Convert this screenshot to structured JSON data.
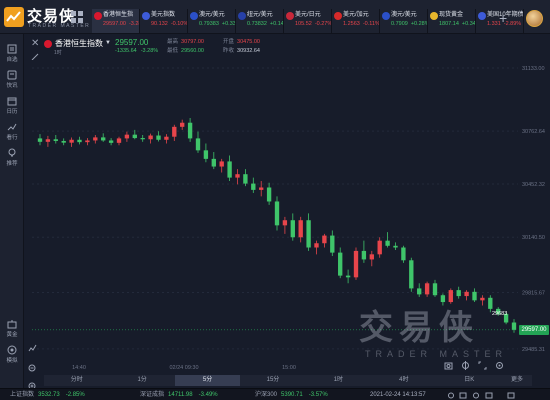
{
  "app": {
    "brand": "交易侠",
    "brand_sub": "TRADER MASTER"
  },
  "colors": {
    "up": "#3fc56a",
    "down": "#e8454b",
    "accent": "#f0a020",
    "background": "#171c2a"
  },
  "tabs": [
    {
      "name": "香港恒生指",
      "value": "29597.00",
      "change": "-3.28%",
      "dir": "down",
      "flag": "#d8182e",
      "active": true
    },
    {
      "name": "美元指数",
      "value": "90.132",
      "change": "-0.10%",
      "dir": "down",
      "flag": "#3d5bd9",
      "active": false
    },
    {
      "name": "澳元/美元",
      "value": "0.79383",
      "change": "+0.33%",
      "dir": "up",
      "flag": "#2b50c8",
      "active": false
    },
    {
      "name": "纽元/美元",
      "value": "0.73832",
      "change": "+0.14%",
      "dir": "up",
      "flag": "#2740a8",
      "active": false
    },
    {
      "name": "美元/日元",
      "value": "105.52",
      "change": "-0.27%",
      "dir": "down",
      "flag": "#c8283a",
      "active": false
    },
    {
      "name": "美元/加元",
      "value": "1.2563",
      "change": "-0.11%",
      "dir": "down",
      "flag": "#d62a2a",
      "active": false
    },
    {
      "name": "澳元/美元",
      "value": "0.7909",
      "change": "+0.28%",
      "dir": "up",
      "flag": "#2b50c8",
      "active": false
    },
    {
      "name": "现货黄金",
      "value": "1807.14",
      "change": "+0.34%",
      "dir": "up",
      "flag": "#e7b62c",
      "active": false
    },
    {
      "name": "美国10年期债...",
      "value": "1.331",
      "change": "-2.89%",
      "dir": "down",
      "flag": "#3d5bd9",
      "active": false
    }
  ],
  "sidebar": [
    {
      "label": "自选",
      "icon": "star-icon"
    },
    {
      "label": "快讯",
      "icon": "news-icon"
    },
    {
      "label": "日历",
      "icon": "calendar-icon"
    },
    {
      "label": "看行",
      "icon": "trend-icon"
    },
    {
      "label": "推荐",
      "icon": "bulb-icon"
    }
  ],
  "sidebar_bottom": [
    {
      "label": "黄金",
      "icon": "gold-icon"
    },
    {
      "label": "模拟",
      "icon": "simulate-icon"
    }
  ],
  "symbol": {
    "name": "香港恒生指数",
    "sub": "1时",
    "price": "29597.00",
    "change": "-1335.64",
    "change_pct": "-3.28%",
    "stats": [
      {
        "k": "最高",
        "v": "30797.00",
        "dir": "down"
      },
      {
        "k": "开盘",
        "v": "30475.00",
        "dir": "down"
      },
      {
        "k": "最低",
        "v": "29560.00",
        "dir": "up"
      },
      {
        "k": "昨收",
        "v": "30932.64",
        "dir": "neutral"
      }
    ]
  },
  "chart_data": {
    "type": "candlestick",
    "y_ticks": [
      "31133.00",
      "30762.64",
      "30452.32",
      "30140.50",
      "29815.67",
      "29485.31"
    ],
    "x_ticks": [
      "14:40",
      "02/24 09:30",
      "15:00"
    ],
    "last_price": "29597.00",
    "low_label": "29683",
    "ylim": [
      29420,
      31180
    ],
    "candles": [
      [
        30720,
        30745,
        30680,
        30700
      ],
      [
        30700,
        30735,
        30670,
        30715
      ],
      [
        30715,
        30740,
        30690,
        30705
      ],
      [
        30705,
        30720,
        30680,
        30695
      ],
      [
        30695,
        30725,
        30670,
        30712
      ],
      [
        30712,
        30730,
        30685,
        30698
      ],
      [
        30698,
        30722,
        30680,
        30708
      ],
      [
        30708,
        30740,
        30690,
        30726
      ],
      [
        30726,
        30750,
        30700,
        30708
      ],
      [
        30708,
        30722,
        30680,
        30694
      ],
      [
        30694,
        30730,
        30680,
        30720
      ],
      [
        30720,
        30760,
        30700,
        30742
      ],
      [
        30742,
        30770,
        30715,
        30722
      ],
      [
        30722,
        30740,
        30700,
        30715
      ],
      [
        30715,
        30748,
        30690,
        30737
      ],
      [
        30737,
        30762,
        30702,
        30712
      ],
      [
        30712,
        30745,
        30690,
        30730
      ],
      [
        30730,
        30800,
        30705,
        30788
      ],
      [
        30788,
        30830,
        30770,
        30812
      ],
      [
        30812,
        30840,
        30700,
        30720
      ],
      [
        30720,
        30760,
        30635,
        30650
      ],
      [
        30650,
        30690,
        30580,
        30600
      ],
      [
        30600,
        30640,
        30540,
        30555
      ],
      [
        30555,
        30600,
        30520,
        30585
      ],
      [
        30585,
        30620,
        30470,
        30490
      ],
      [
        30490,
        30540,
        30450,
        30510
      ],
      [
        30510,
        30540,
        30440,
        30455
      ],
      [
        30455,
        30490,
        30400,
        30418
      ],
      [
        30418,
        30470,
        30380,
        30432
      ],
      [
        30432,
        30460,
        30330,
        30350
      ],
      [
        30350,
        30380,
        30180,
        30210
      ],
      [
        30210,
        30260,
        30160,
        30240
      ],
      [
        30240,
        30280,
        30120,
        30140
      ],
      [
        30140,
        30260,
        30110,
        30240
      ],
      [
        30240,
        30280,
        30060,
        30080
      ],
      [
        30080,
        30120,
        30040,
        30105
      ],
      [
        30105,
        30160,
        30080,
        30150
      ],
      [
        30150,
        30180,
        30030,
        30050
      ],
      [
        30050,
        30080,
        29900,
        29915
      ],
      [
        29915,
        29950,
        29870,
        29905
      ],
      [
        29905,
        30080,
        29890,
        30060
      ],
      [
        30060,
        30120,
        29990,
        30010
      ],
      [
        30010,
        30060,
        29970,
        30040
      ],
      [
        30040,
        30140,
        30020,
        30120
      ],
      [
        30120,
        30170,
        30080,
        30090
      ],
      [
        30090,
        30110,
        30065,
        30080
      ],
      [
        30080,
        30090,
        29990,
        30005
      ],
      [
        30005,
        30020,
        29820,
        29840
      ],
      [
        29840,
        29870,
        29790,
        29805
      ],
      [
        29805,
        29880,
        29790,
        29870
      ],
      [
        29870,
        29890,
        29790,
        29800
      ],
      [
        29800,
        29810,
        29740,
        29760
      ],
      [
        29760,
        29840,
        29750,
        29830
      ],
      [
        29830,
        29850,
        29780,
        29795
      ],
      [
        29795,
        29830,
        29770,
        29820
      ],
      [
        29820,
        29840,
        29760,
        29770
      ],
      [
        29770,
        29800,
        29740,
        29785
      ],
      [
        29785,
        29800,
        29700,
        29720
      ],
      [
        29720,
        29730,
        29680,
        29690
      ],
      [
        29690,
        29700,
        29630,
        29640
      ],
      [
        29640,
        29660,
        29580,
        29597
      ]
    ]
  },
  "periods": [
    "分时",
    "1分",
    "5分",
    "15分",
    "1时",
    "4时",
    "日K"
  ],
  "active_period": "5分",
  "period_more": "更多",
  "watermark": {
    "main": "交易侠",
    "sub": "TRADER MASTER"
  },
  "statusbar": [
    {
      "n": "上证指数",
      "v": "3532.73",
      "c": "-2.85%"
    },
    {
      "n": "深证成指",
      "v": "14711.98",
      "c": "-3.49%"
    },
    {
      "n": "沪深300",
      "v": "5390.71",
      "c": "-3.57%"
    }
  ],
  "clock": "2021-02-24 14:13:57"
}
